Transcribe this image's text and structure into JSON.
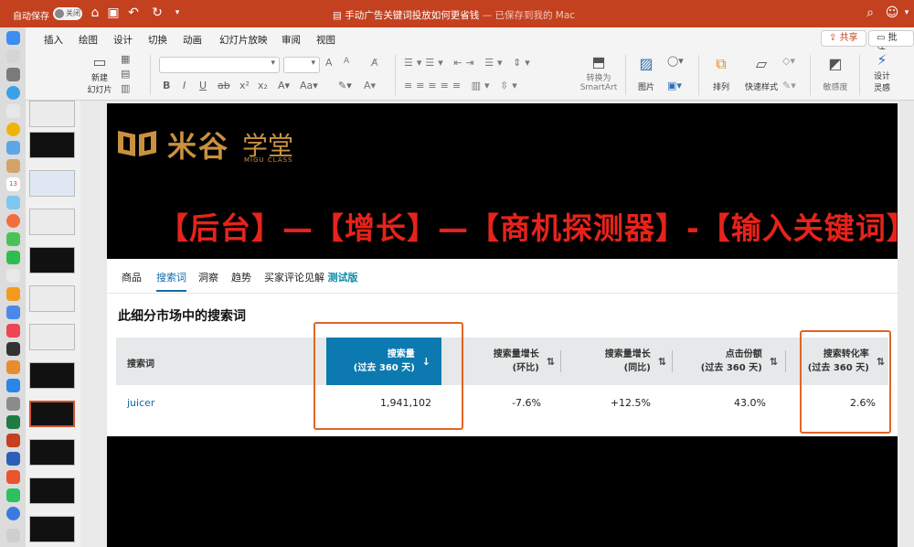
{
  "titlebar": {
    "autosave_label": "自动保存",
    "toggle_label": "关闭",
    "doc_title": "手动广告关键词投放如何更省钱",
    "doc_status": " — 已保存到我的 Mac",
    "bg_color": "#c4411f"
  },
  "ribbon": {
    "tabs": [
      "插入",
      "绘图",
      "设计",
      "切换",
      "动画",
      "幻灯片放映",
      "审阅",
      "视图"
    ],
    "share_label": "共享",
    "comment_label": "批注",
    "new_slide_line1": "新建",
    "new_slide_line2": "幻灯片",
    "convert_smartart_line1": "转换为",
    "convert_smartart_line2": "SmartArt",
    "picture_label": "图片",
    "arrange_label": "排列",
    "quick_styles_label": "快速样式",
    "sensitivity_label": "敏感度",
    "design_ideas_line1": "设计",
    "design_ideas_line2": "灵感"
  },
  "thumbnails": {
    "number_visible": "13"
  },
  "slide": {
    "logo_text": "米谷",
    "logo_sub": "学堂",
    "logo_en": "MIGU CLASS",
    "headline": "【后台】—【增长】—【商机探测器】-【输入关键词】",
    "brand_color": "#c9913f",
    "headline_color": "#e6231b"
  },
  "web": {
    "tabs": [
      "商品",
      "搜索词",
      "洞察",
      "趋势",
      "买家评论见解"
    ],
    "beta_label": "测试版",
    "section_title": "此细分市场中的搜索词",
    "columns": {
      "keyword": "搜索词",
      "search_volume_l1": "搜索量",
      "search_volume_l2": "(过去 360 天)",
      "growth_qoq_l1": "搜索量增长",
      "growth_qoq_l2": "(环比)",
      "growth_yoy_l1": "搜索量增长",
      "growth_yoy_l2": "(同比)",
      "click_share_l1": "点击份额",
      "click_share_l2": "(过去 360 天)",
      "conversion_l1": "搜索转化率",
      "conversion_l2": "(过去 360 天)"
    },
    "row": {
      "keyword": "juicer",
      "search_volume": "1,941,102",
      "growth_qoq": "-7.6%",
      "growth_yoy": "+12.5%",
      "click_share": "43.0%",
      "conversion": "2.6%"
    },
    "active_color": "#0c7ab0",
    "highlight_color": "#e26527"
  }
}
